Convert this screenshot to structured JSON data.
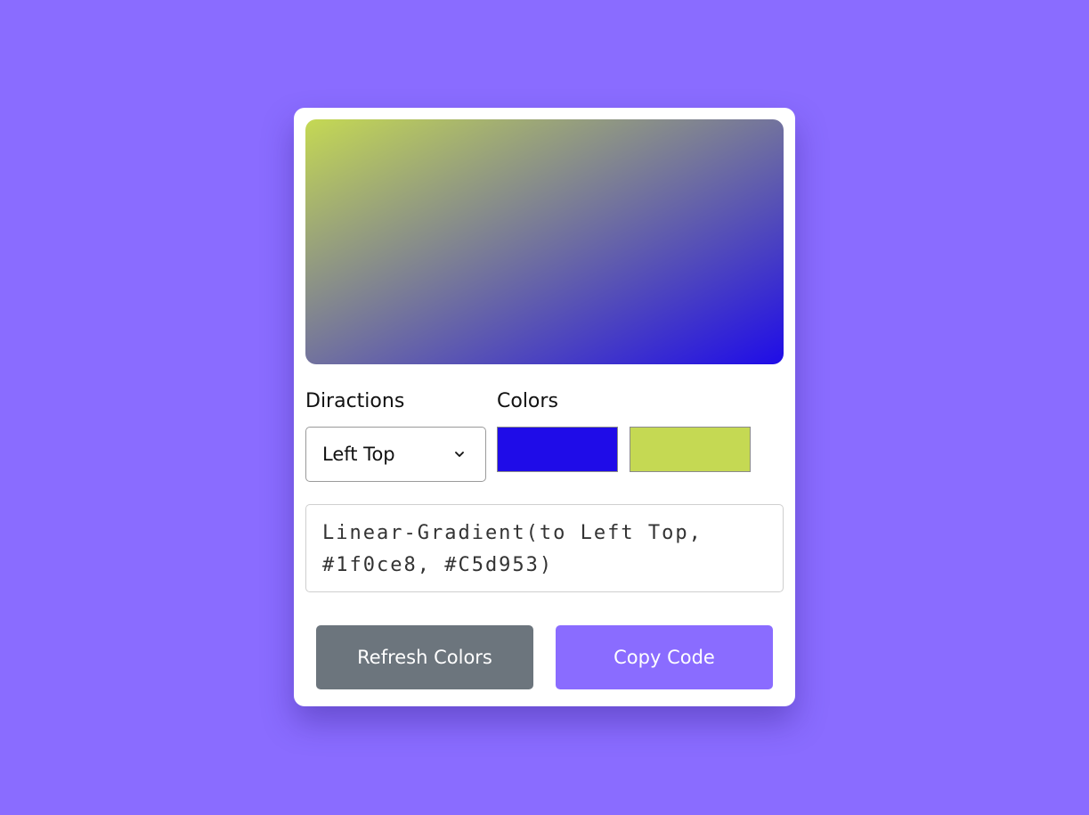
{
  "page": {
    "background_color": "#8a6cff"
  },
  "preview": {
    "direction": "to left top",
    "color_start": "#1f0ce8",
    "color_end": "#c5d953"
  },
  "directions": {
    "label": "Diractions",
    "selected": "Left Top",
    "icon": "chevron-down-icon"
  },
  "colors": {
    "label": "Colors",
    "swatches": [
      "#1f0ce8",
      "#c5d953"
    ]
  },
  "code": {
    "text": "Linear-Gradient(to Left Top, #1f0ce8, #C5d953)"
  },
  "buttons": {
    "refresh_label": "Refresh Colors",
    "refresh_color": "#6c757d",
    "copy_label": "Copy Code",
    "copy_color": "#8a6cff"
  }
}
